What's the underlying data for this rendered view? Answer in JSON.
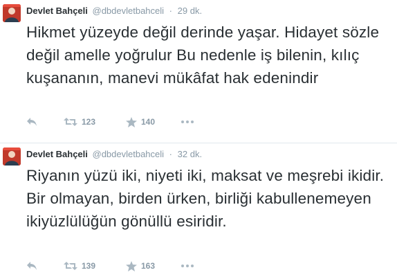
{
  "tweets": [
    {
      "author": "Devlet Bahçeli",
      "handle": "@dbdevletbahceli",
      "separator": "·",
      "time": "29 dk.",
      "text": "Hikmet yüzeyde değil derinde yaşar. Hidayet sözle değil amelle yoğrulur Bu nedenle iş bilenin, kılıç kuşananın, manevi mükâfat hak edenindir",
      "retweets": "123",
      "favorites": "140"
    },
    {
      "author": "Devlet Bahçeli",
      "handle": "@dbdevletbahceli",
      "separator": "·",
      "time": "32 dk.",
      "text": "Riyanın yüzü iki, niyeti iki, maksat ve meşrebi ikidir. Bir olmayan, birden ürken, birliği kabullenemeyen ikiyüzlülüğün gönüllü esiridir.",
      "retweets": "139",
      "favorites": "163"
    }
  ],
  "icons": {
    "reply": "reply-icon",
    "retweet": "retweet-icon",
    "favorite": "star-icon",
    "more": "more-icon"
  },
  "colors": {
    "text": "#292f33",
    "muted": "#8899a6",
    "icon": "#aab8c2",
    "avatar": "#c0392b",
    "divider": "#e1e8ed"
  }
}
